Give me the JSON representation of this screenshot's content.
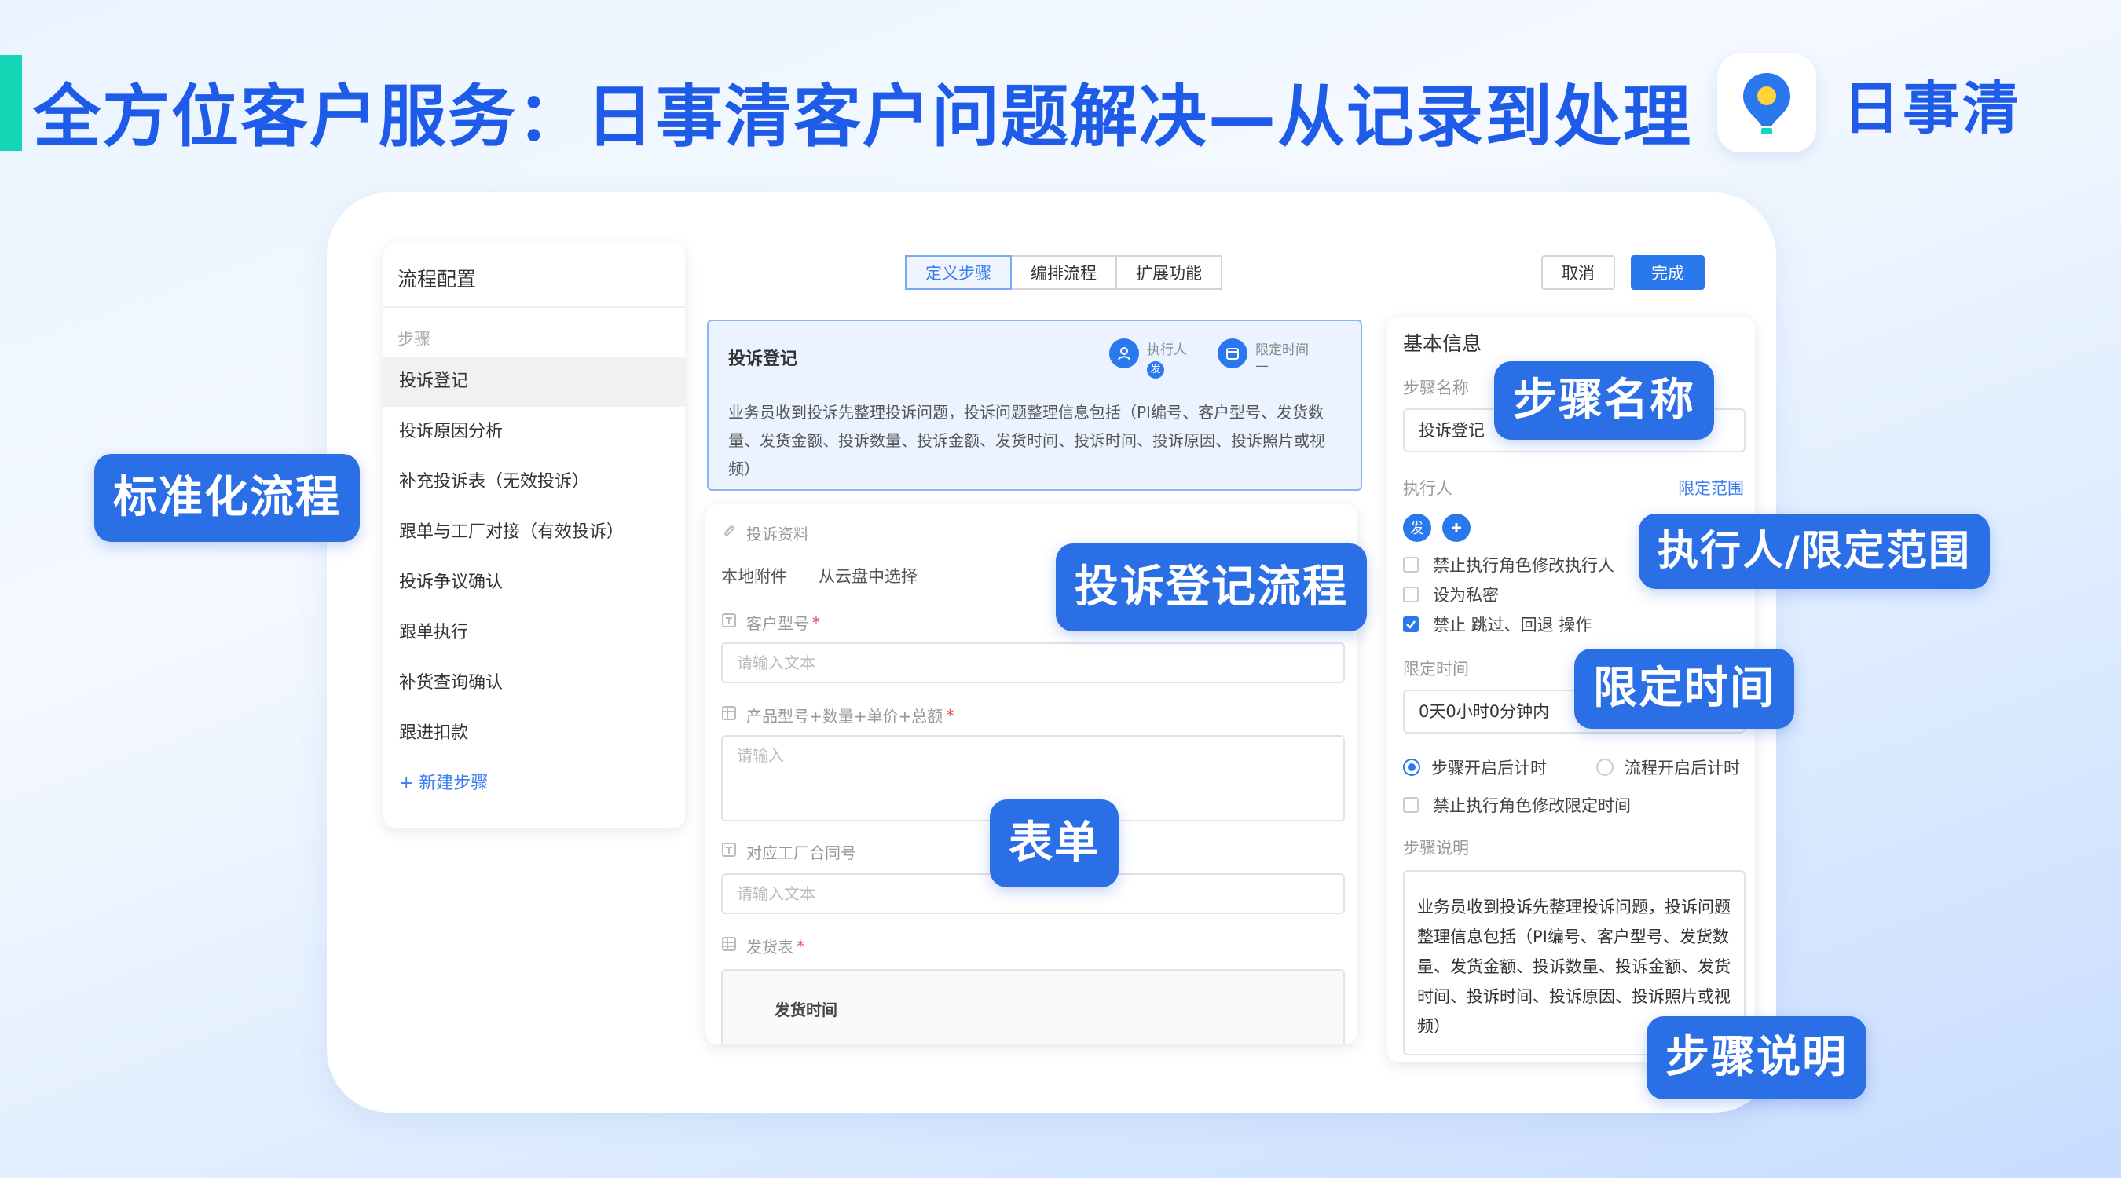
{
  "headline": "全方位客户服务：日事清客户问题解决—从记录到处理",
  "brand": {
    "name": "日事清",
    "logo_icon": "location-pin-bulb-icon"
  },
  "steps_panel": {
    "title": "流程配置",
    "subtitle": "步骤",
    "items": [
      {
        "label": "投诉登记",
        "active": true
      },
      {
        "label": "投诉原因分析"
      },
      {
        "label": "补充投诉表（无效投诉）"
      },
      {
        "label": "跟单与工厂对接（有效投诉）"
      },
      {
        "label": "投诉争议确认"
      },
      {
        "label": "跟单执行"
      },
      {
        "label": "补货查询确认"
      },
      {
        "label": "跟进扣款"
      }
    ],
    "add_label": "+ 新建步骤"
  },
  "toolbar": {
    "tabs": [
      {
        "label": "定义步骤",
        "active": true
      },
      {
        "label": "编排流程"
      },
      {
        "label": "扩展功能"
      }
    ],
    "cancel_label": "取消",
    "done_label": "完成"
  },
  "complaint_box": {
    "title": "投诉登记",
    "executor_label": "执行人",
    "executor_badge": "发",
    "time_label": "限定时间",
    "time_value": "—",
    "description": "业务员收到投诉先整理投诉问题，投诉问题整理信息包括（PI编号、客户型号、发货数量、发货金额、投诉数量、投诉金额、发货时间、投诉时间、投诉原因、投诉照片或视频）"
  },
  "form": {
    "attachment_label": "投诉资料",
    "local_attach": "本地附件",
    "cloud_select": "从云盘中选择",
    "fields": [
      {
        "label": "客户型号",
        "required": true,
        "placeholder": "请输入文本"
      },
      {
        "label": "产品型号+数量+单价+总额",
        "required": true,
        "placeholder": "请输入"
      },
      {
        "label": "对应工厂合同号",
        "required": false,
        "placeholder": "请输入文本"
      },
      {
        "label": "发货表",
        "required": true
      }
    ],
    "table_header": "发货时间"
  },
  "info_panel": {
    "title": "基本信息",
    "step_name_label": "步骤名称",
    "step_name_value": "投诉登记",
    "executor_label": "执行人",
    "executor_badge": "发",
    "limit_range_link": "限定范围",
    "options": [
      {
        "label": "禁止执行角色修改执行人",
        "checked": false
      },
      {
        "label": "设为私密",
        "checked": false
      },
      {
        "label": "禁止 跳过、回退 操作",
        "checked": true
      }
    ],
    "time_label": "限定时间",
    "time_value": "0天0小时0分钟内",
    "radio_step": "步骤开启后计时",
    "radio_flow": "流程开启后计时",
    "forbid_time_edit": "禁止执行角色修改限定时间",
    "desc_label": "步骤说明",
    "desc_value": "业务员收到投诉先整理投诉问题，投诉问题整理信息包括（PI编号、客户型号、发货数量、发货金额、投诉数量、投诉金额、发货时间、投诉时间、投诉原因、投诉照片或视频）"
  },
  "callouts": {
    "standard": "标准化流程",
    "complaint_flow": "投诉登记流程",
    "form": "表单",
    "step_name": "步骤名称",
    "executor": "执行人/限定范围",
    "limit_time": "限定时间",
    "step_desc": "步骤说明"
  },
  "colors": {
    "primary": "#2a6fe6",
    "headline": "#1e5be8",
    "accent_bar": "#12d6b5"
  }
}
